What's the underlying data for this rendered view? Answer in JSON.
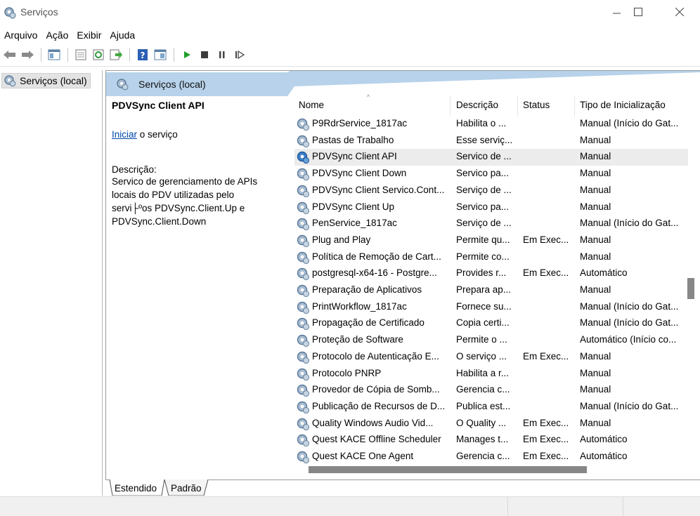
{
  "window": {
    "title": "Serviços"
  },
  "menu": [
    "Arquivo",
    "Ação",
    "Exibir",
    "Ajuda"
  ],
  "toolbar": {
    "buttons": [
      "back-icon",
      "forward-icon",
      "show-hide-tree-icon",
      "properties-icon",
      "refresh-icon",
      "export-list-icon",
      "help-icon",
      "console-view-icon",
      "start-service-icon",
      "stop-service-icon",
      "pause-service-icon",
      "resume-service-icon"
    ]
  },
  "tree": {
    "root_label": "Serviços (local)"
  },
  "pane": {
    "header_title": "Serviços (local)",
    "selected_service_name": "PDVSync Client API",
    "start_link": "Iniciar",
    "start_suffix": " o serviço",
    "description_label": "Descrição:",
    "description_text": "Servico de gerenciamento de APIs locais do PDV utilizadas pelo servi├ºos PDVSync.Client.Up e PDVSync.Client.Down"
  },
  "columns": [
    "Nome",
    "Descrição",
    "Status",
    "Tipo de Inicialização"
  ],
  "services": [
    {
      "name": "P9RdrService_1817ac",
      "desc": "Habilita o ...",
      "status": "",
      "startup": "Manual (Início do Gat..."
    },
    {
      "name": "Pastas de Trabalho",
      "desc": "Esse serviç...",
      "status": "",
      "startup": "Manual"
    },
    {
      "name": "PDVSync Client API",
      "desc": "Servico de ...",
      "status": "",
      "startup": "Manual",
      "selected": true
    },
    {
      "name": "PDVSync Client Down",
      "desc": "Servico pa...",
      "status": "",
      "startup": "Manual"
    },
    {
      "name": "PDVSync Client Servico.Cont...",
      "desc": "Serviço de ...",
      "status": "",
      "startup": "Manual"
    },
    {
      "name": "PDVSync Client Up",
      "desc": "Servico pa...",
      "status": "",
      "startup": "Manual"
    },
    {
      "name": "PenService_1817ac",
      "desc": "Serviço de ...",
      "status": "",
      "startup": "Manual (Início do Gat..."
    },
    {
      "name": "Plug and Play",
      "desc": "Permite qu...",
      "status": "Em Exec...",
      "startup": "Manual"
    },
    {
      "name": "Política de Remoção de Cart...",
      "desc": "Permite co...",
      "status": "",
      "startup": "Manual"
    },
    {
      "name": "postgresql-x64-16 - Postgre...",
      "desc": "Provides r...",
      "status": "Em Exec...",
      "startup": "Automático"
    },
    {
      "name": "Preparação de Aplicativos",
      "desc": "Prepara ap...",
      "status": "",
      "startup": "Manual"
    },
    {
      "name": "PrintWorkflow_1817ac",
      "desc": "Fornece su...",
      "status": "",
      "startup": "Manual (Início do Gat..."
    },
    {
      "name": "Propagação de Certificado",
      "desc": "Copia certi...",
      "status": "",
      "startup": "Manual (Início do Gat..."
    },
    {
      "name": "Proteção de Software",
      "desc": "Permite o ...",
      "status": "",
      "startup": "Automático (Início co..."
    },
    {
      "name": "Protocolo de Autenticação E...",
      "desc": "O serviço ...",
      "status": "Em Exec...",
      "startup": "Manual"
    },
    {
      "name": "Protocolo PNRP",
      "desc": "Habilita a r...",
      "status": "",
      "startup": "Manual"
    },
    {
      "name": "Provedor de Cópia de Somb...",
      "desc": "Gerencia c...",
      "status": "",
      "startup": "Manual"
    },
    {
      "name": "Publicação de Recursos de D...",
      "desc": "Publica est...",
      "status": "",
      "startup": "Manual (Início do Gat..."
    },
    {
      "name": "Quality Windows Audio Vid...",
      "desc": "O Quality ...",
      "status": "Em Exec...",
      "startup": "Manual"
    },
    {
      "name": "Quest KACE Offline Scheduler",
      "desc": "Manages t...",
      "status": "Em Exec...",
      "startup": "Automático"
    },
    {
      "name": "Quest KACE One Agent",
      "desc": "Gerencia c...",
      "status": "Em Exec...",
      "startup": "Automático"
    }
  ],
  "tabs": [
    "Estendido",
    "Padrão"
  ],
  "colors": {
    "header_blue": "#b7d2ea",
    "link": "#0047ab",
    "selected_row": "#ececec"
  }
}
